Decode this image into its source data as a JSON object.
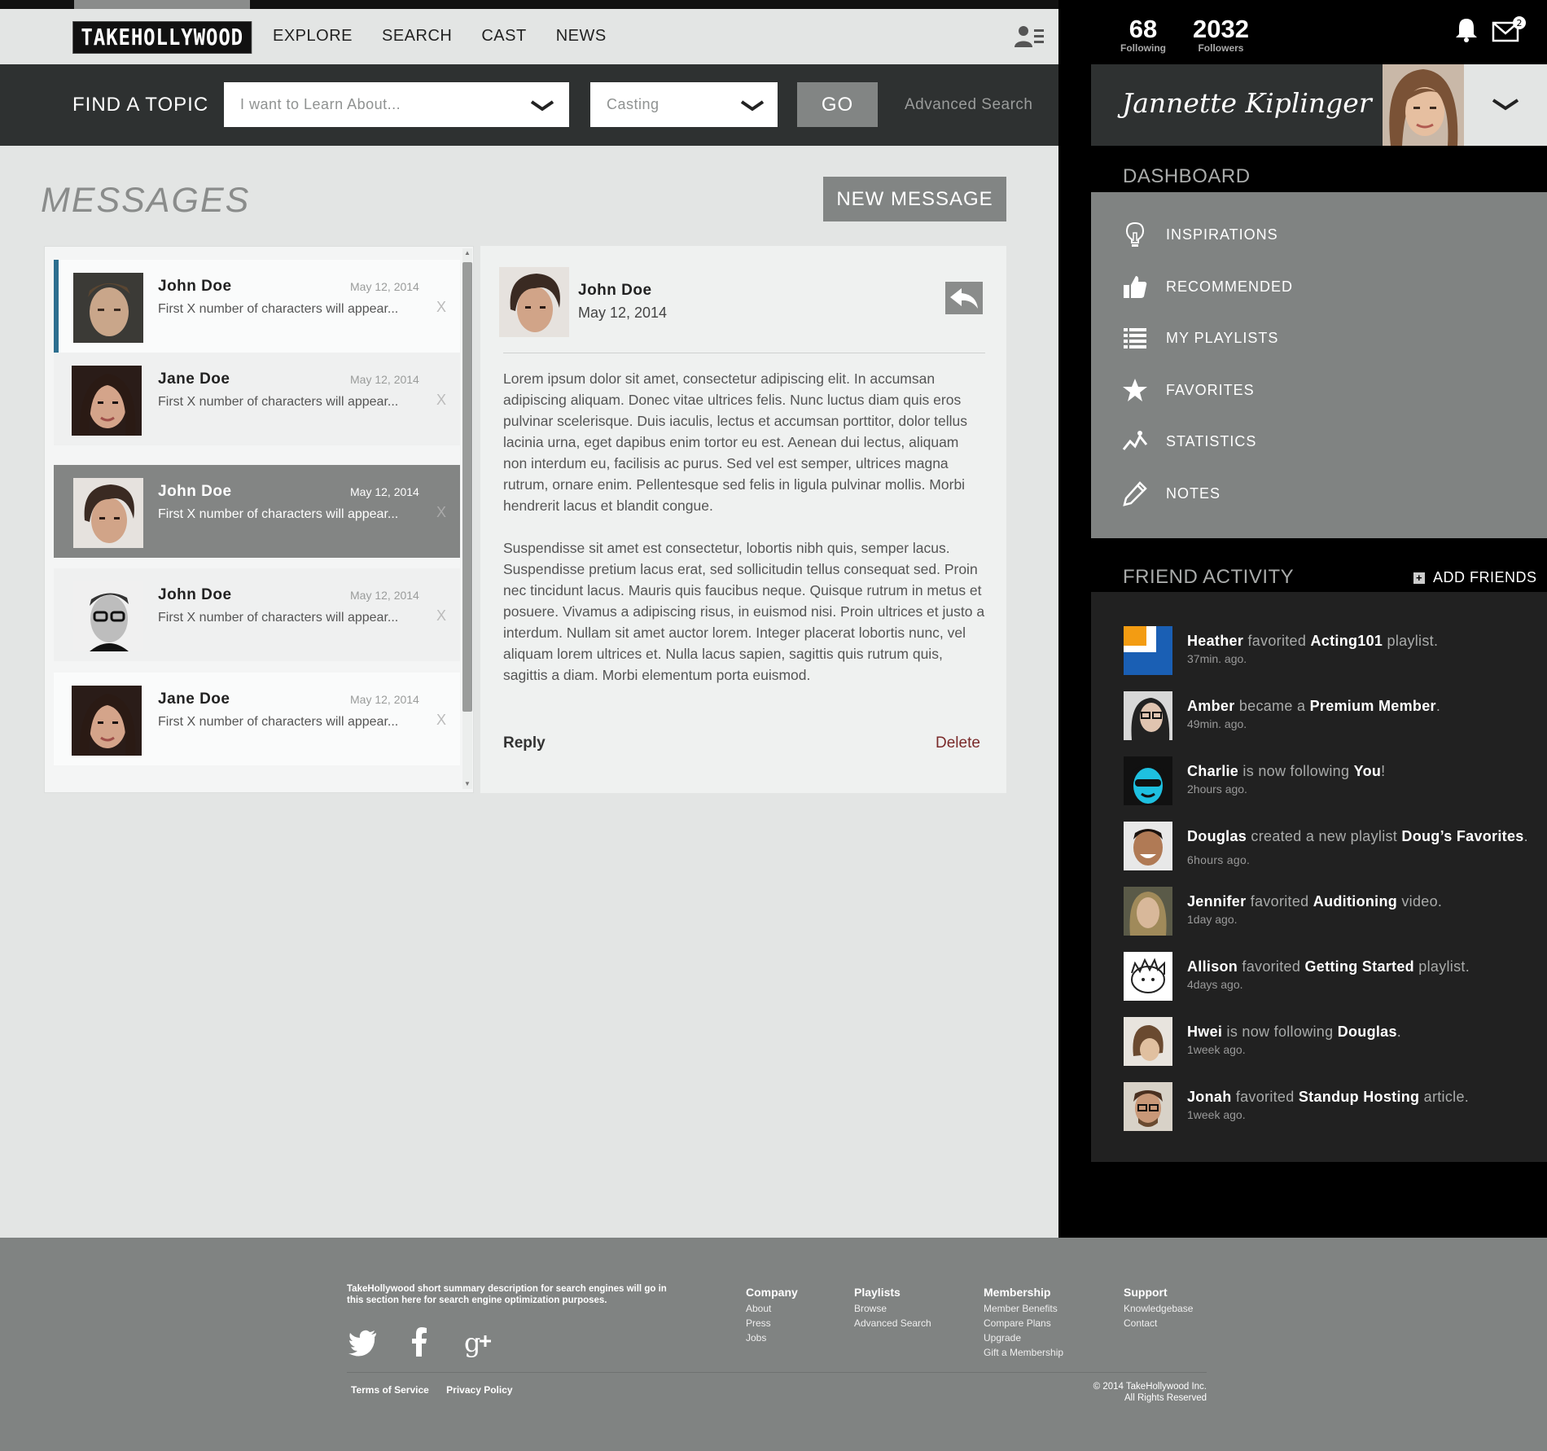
{
  "header": {
    "logo": "TAKEHOLLYWOOD",
    "nav": [
      "EXPLORE",
      "SEARCH",
      "CAST",
      "NEWS"
    ]
  },
  "findbar": {
    "label": "FIND A TOPIC",
    "topic_placeholder": "I want to Learn About...",
    "category_value": "Casting",
    "go_label": "GO",
    "advanced_search": "Advanced Search"
  },
  "messages": {
    "title": "MESSAGES",
    "new_message": "NEW MESSAGE",
    "items": [
      {
        "name": "John Doe",
        "date": "May 12, 2014",
        "preview": "First X number of characters will appear...",
        "remove": "X"
      },
      {
        "name": "Jane Doe",
        "date": "May 12, 2014",
        "preview": "First X number of characters will appear...",
        "remove": "X"
      },
      {
        "name": "John Doe",
        "date": "May 12, 2014",
        "preview": "First X number of characters will appear...",
        "remove": "X"
      },
      {
        "name": "John Doe",
        "date": "May 12, 2014",
        "preview": "First X number of characters will appear...",
        "remove": "X"
      },
      {
        "name": "Jane Doe",
        "date": "May 12, 2014",
        "preview": "First X number of characters will appear...",
        "remove": "X"
      }
    ],
    "detail": {
      "name": "John Doe",
      "date": "May 12, 2014",
      "paragraph1": "Lorem ipsum dolor sit amet, consectetur adipiscing elit. In accumsan adipiscing aliquam. Donec vitae ultrices felis. Nunc luctus diam quis eros pulvinar scelerisque. Duis iaculis, lectus et accumsan porttitor, dolor tellus lacinia urna, eget dapibus enim tortor eu est. Aenean dui lectus, aliquam non interdum eu, facilisis ac purus. Sed vel est semper, ultrices magna rutrum, ornare enim. Pellentesque sed felis in ligula pulvinar mollis. Morbi hendrerit lacus et blandit congue.",
      "paragraph2": "Suspendisse sit amet est consectetur, lobortis nibh quis, semper lacus. Suspendisse pretium lacus erat, sed sollicitudin tellus consequat sed. Proin nec tincidunt lacus. Mauris quis faucibus neque. Quisque rutrum in metus et posuere. Vivamus a adipiscing risus, in euismod nisi. Proin ultrices et justo a interdum. Nullam sit amet auctor lorem. Integer placerat lobortis nunc, vel aliquam lorem ultrices et. Nulla lacus sapien, sagittis quis rutrum quis, sagittis a diam. Morbi elementum porta euismod.",
      "reply": "Reply",
      "delete": "Delete"
    }
  },
  "sidebar": {
    "following_count": "68",
    "following_label": "Following",
    "followers_count": "2032",
    "followers_label": "Followers",
    "mail_badge": "2",
    "user_name": "Jannette Kiplinger",
    "dashboard_title": "DASHBOARD",
    "dashboard_items": [
      {
        "label": "INSPIRATIONS",
        "icon": "lightbulb-icon"
      },
      {
        "label": "RECOMMENDED",
        "icon": "thumbs-up-icon"
      },
      {
        "label": "MY PLAYLISTS",
        "icon": "list-icon"
      },
      {
        "label": "FAVORITES",
        "icon": "star-icon"
      },
      {
        "label": "STATISTICS",
        "icon": "chart-line-icon"
      },
      {
        "label": "NOTES",
        "icon": "pencil-icon"
      }
    ],
    "friend_activity_title": "FRIEND ACTIVITY",
    "add_friends": "ADD FRIENDS",
    "activity": [
      {
        "who": "Heather",
        "mid": " favorited ",
        "what": "Acting101",
        "end": " playlist.",
        "time": "37min. ago."
      },
      {
        "who": "Amber",
        "mid": " became a ",
        "what": "Premium Member",
        "end": ".",
        "time": "49min. ago."
      },
      {
        "who": "Charlie",
        "mid": " is now following ",
        "what": "You",
        "end": "!",
        "time": "2hours ago."
      },
      {
        "who": "Douglas",
        "mid": " created a new playlist ",
        "what": "Doug’s Favorites",
        "end": ".",
        "time": "6hours ago."
      },
      {
        "who": "Jennifer",
        "mid": " favorited ",
        "what": "Auditioning",
        "end": " video.",
        "time": "1day ago."
      },
      {
        "who": "Allison",
        "mid": " favorited ",
        "what": "Getting Started",
        "end": " playlist.",
        "time": "4days ago."
      },
      {
        "who": "Hwei",
        "mid": " is now following ",
        "what": "Douglas",
        "end": ".",
        "time": "1week ago."
      },
      {
        "who": "Jonah",
        "mid": " favorited ",
        "what": "Standup Hosting",
        "end": " article.",
        "time": "1week ago."
      }
    ]
  },
  "footer": {
    "description": "TakeHollywood short summary description for  search engines will go in this section here for search engine optimization purposes.",
    "columns": [
      {
        "heading": "Company",
        "links": [
          "About",
          "Press",
          "Jobs"
        ]
      },
      {
        "heading": "Playlists",
        "links": [
          "Browse",
          "Advanced Search"
        ]
      },
      {
        "heading": "Membership",
        "links": [
          "Member Benefits",
          "Compare Plans",
          "Upgrade",
          "Gift a Membership"
        ]
      },
      {
        "heading": "Support",
        "links": [
          "Knowledgebase",
          "Contact"
        ]
      }
    ],
    "terms": "Terms of Service",
    "privacy": "Privacy Policy",
    "copyright_line1": "© 2014 TakeHollywood Inc.",
    "copyright_line2": "All Rights Reserved"
  },
  "colors": {
    "accent_blue": "#2c6e8f",
    "delete_red": "#7a2a2a",
    "button_grey": "#828584"
  }
}
